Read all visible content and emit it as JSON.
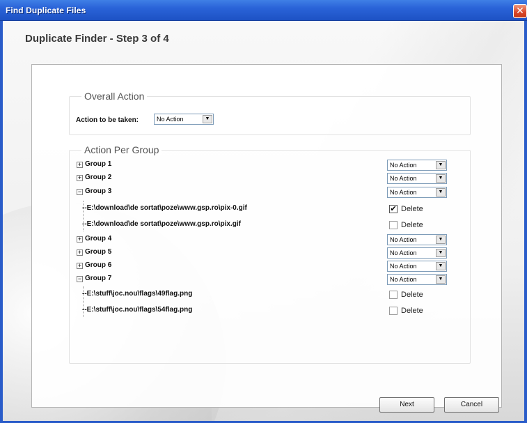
{
  "window": {
    "title": "Find Duplicate Files",
    "close_glyph": "✕"
  },
  "heading": "Duplicate Finder - Step 3 of 4",
  "overall": {
    "legend": "Overall Action",
    "label": "Action to be taken:",
    "selected": "No Action"
  },
  "per_group": {
    "legend": "Action Per Group",
    "groups": [
      {
        "label": "Group 1",
        "expander": "+",
        "action": "No Action"
      },
      {
        "label": "Group 2",
        "expander": "+",
        "action": "No Action"
      },
      {
        "label": "Group 3",
        "expander": "−",
        "action": "No Action",
        "files": [
          {
            "path": "--E:\\download\\de sortat\\poze\\www.gsp.ro\\pix-0.gif",
            "checked": true,
            "check_label": "Delete"
          },
          {
            "path": "--E:\\download\\de sortat\\poze\\www.gsp.ro\\pix.gif",
            "checked": false,
            "check_label": "Delete"
          }
        ]
      },
      {
        "label": "Group 4",
        "expander": "+",
        "action": "No Action"
      },
      {
        "label": "Group 5",
        "expander": "+",
        "action": "No Action"
      },
      {
        "label": "Group 6",
        "expander": "+",
        "action": "No Action"
      },
      {
        "label": "Group 7",
        "expander": "−",
        "action": "No Action",
        "files": [
          {
            "path": "--E:\\stuff\\joc.nou\\flags\\49flag.png",
            "checked": false,
            "check_label": "Delete"
          },
          {
            "path": "--E:\\stuff\\joc.nou\\flags\\54flag.png",
            "checked": false,
            "check_label": "Delete"
          }
        ]
      }
    ]
  },
  "buttons": {
    "next": "Next",
    "cancel": "Cancel"
  },
  "dropdown_arrow": "▼",
  "check_mark": "✔",
  "icons": {
    "close": "close-icon",
    "expand": "plus-box-icon",
    "collapse": "minus-box-icon",
    "dropdown": "chevron-down-icon"
  }
}
